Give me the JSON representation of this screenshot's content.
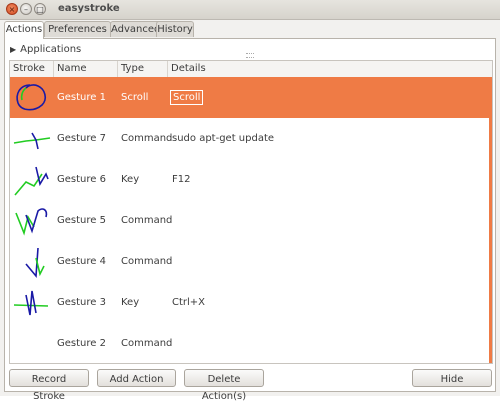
{
  "window": {
    "title": "easystroke"
  },
  "tabs": [
    {
      "label": "Actions",
      "active": true
    },
    {
      "label": "Preferences",
      "active": false
    },
    {
      "label": "Advanced",
      "active": false
    },
    {
      "label": "History",
      "active": false
    }
  ],
  "applications_label": "Applications",
  "table": {
    "columns": [
      "Stroke",
      "Name",
      "Type",
      "Details"
    ],
    "rows": [
      {
        "name": "Gesture 1",
        "type": "Scroll",
        "details": "Scroll",
        "selected": true
      },
      {
        "name": "Gesture 7",
        "type": "Command",
        "details": "sudo apt-get update",
        "selected": false
      },
      {
        "name": "Gesture 6",
        "type": "Key",
        "details": "F12",
        "selected": false
      },
      {
        "name": "Gesture 5",
        "type": "Command",
        "details": "",
        "selected": false
      },
      {
        "name": "Gesture 4",
        "type": "Command",
        "details": "",
        "selected": false
      },
      {
        "name": "Gesture 3",
        "type": "Key",
        "details": "Ctrl+X",
        "selected": false
      },
      {
        "name": "Gesture 2",
        "type": "Command",
        "details": "",
        "selected": false
      }
    ]
  },
  "buttons": {
    "record": "Record Stroke",
    "add": "Add Action",
    "delete": "Delete Action(s)",
    "hide": "Hide"
  },
  "colors": {
    "selection": "#ef7b45",
    "stroke_green": "#22cc22",
    "stroke_blue": "#1a1aa6"
  }
}
